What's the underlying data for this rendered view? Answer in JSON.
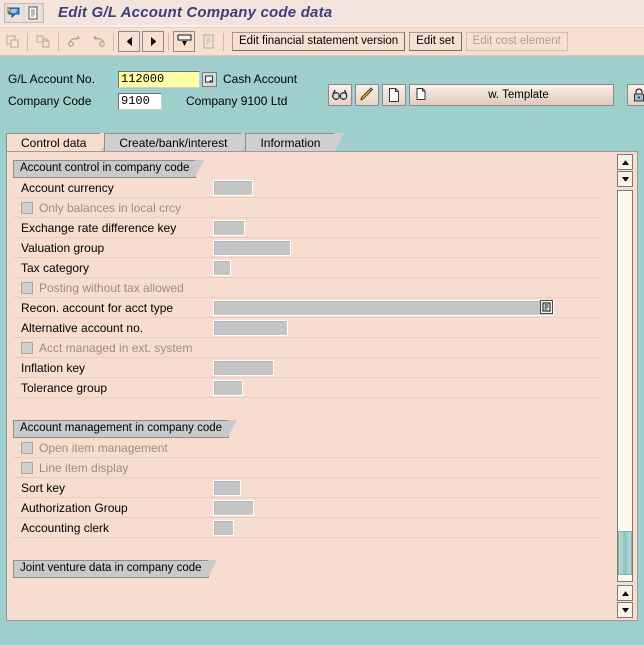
{
  "title": {
    "text": "Edit G/L Account Company code data",
    "icons": [
      "sap-logo-icon",
      "document-icon"
    ]
  },
  "toolbar": {
    "icon_buttons": [
      {
        "name": "copy-icon",
        "enabled": false
      },
      {
        "name": "copy-to-icon",
        "enabled": false
      },
      {
        "name": "undo-icon",
        "enabled": false
      },
      {
        "name": "redo-icon",
        "enabled": false
      },
      {
        "name": "previous-arrow-icon",
        "enabled": true
      },
      {
        "name": "next-arrow-icon",
        "enabled": true
      },
      {
        "name": "display-change-icon",
        "enabled": true
      },
      {
        "name": "note-icon",
        "enabled": false
      }
    ],
    "buttons": [
      {
        "label": "Edit financial statement version",
        "enabled": true
      },
      {
        "label": "Edit set",
        "enabled": true
      },
      {
        "label": "Edit cost element",
        "enabled": false
      }
    ]
  },
  "header": {
    "gl_account": {
      "label": "G/L Account No.",
      "value": "112000",
      "description": "Cash Account",
      "match_icon": "match-code-icon"
    },
    "company_code": {
      "label": "Company Code",
      "value": "9100",
      "description": "Company 9100 Ltd"
    },
    "icon_buttons": [
      {
        "name": "glasses-icon",
        "label": ""
      },
      {
        "name": "pencil-edit-icon",
        "label": ""
      },
      {
        "name": "blank-page-icon",
        "label": ""
      }
    ],
    "with_template": {
      "name": "with-template-button",
      "icon": "page-icon",
      "label": "w. Template"
    },
    "right_buttons": [
      {
        "name": "lock-icon",
        "label": ""
      },
      {
        "name": "trash-icon",
        "label": ""
      }
    ]
  },
  "tabs": [
    {
      "label": "Control data",
      "active": true
    },
    {
      "label": "Create/bank/interest",
      "active": false
    },
    {
      "label": "Information",
      "active": false
    }
  ],
  "content": {
    "groups": [
      {
        "title": "Account control in company code",
        "rows": [
          {
            "kind": "field",
            "label": "Account currency",
            "value": "",
            "width": "w-a"
          },
          {
            "kind": "checkbox",
            "label": "Only balances in local crcy",
            "checked": false,
            "disabled": true
          },
          {
            "kind": "field",
            "label": "Exchange rate difference key",
            "value": "",
            "width": "w-b"
          },
          {
            "kind": "field",
            "label": "Valuation group",
            "value": "",
            "width": "w-c"
          },
          {
            "kind": "field",
            "label": "Tax category",
            "value": "",
            "width": "w-d"
          },
          {
            "kind": "checkbox",
            "label": "Posting without tax allowed",
            "checked": false,
            "disabled": true
          },
          {
            "kind": "field-dropdown",
            "label": "Recon. account for acct type",
            "value": "",
            "width": "w-e"
          },
          {
            "kind": "field",
            "label": "Alternative account no.",
            "value": "",
            "width": "w-f"
          },
          {
            "kind": "checkbox",
            "label": "Acct managed in ext. system",
            "checked": false,
            "disabled": true
          },
          {
            "kind": "field",
            "label": "Inflation key",
            "value": "",
            "width": "w-g"
          },
          {
            "kind": "field",
            "label": "Tolerance group",
            "value": "",
            "width": "w-h"
          }
        ]
      },
      {
        "title": "Account management in company code",
        "rows": [
          {
            "kind": "checkbox",
            "label": "Open item management",
            "checked": false,
            "disabled": true
          },
          {
            "kind": "checkbox",
            "label": "Line item display",
            "checked": false,
            "disabled": true
          },
          {
            "kind": "field",
            "label": "Sort key",
            "value": "",
            "width": "w-i"
          },
          {
            "kind": "field",
            "label": "Authorization Group",
            "value": "",
            "width": "w-j"
          },
          {
            "kind": "field",
            "label": "Accounting clerk",
            "value": "",
            "width": "w-k"
          }
        ]
      },
      {
        "title": "Joint venture data in company code",
        "rows": []
      }
    ]
  },
  "scrollbar": {
    "up_arrow": "scroll-up-icon",
    "down_arrow": "scroll-down-icon",
    "thumb_position_percent": 88
  },
  "colors": {
    "window_bg": "#9ecfcd",
    "panel_bg": "#f6ddd0",
    "toolbar_bg": "#f7dfd1",
    "title_text": "#3b3f7a",
    "input_bg": "#c5c5c5",
    "required_input_bg": "#ffffa8",
    "group_tab_bg": "#c9c9c9",
    "scroll_thumb": "#8dc3c2"
  }
}
